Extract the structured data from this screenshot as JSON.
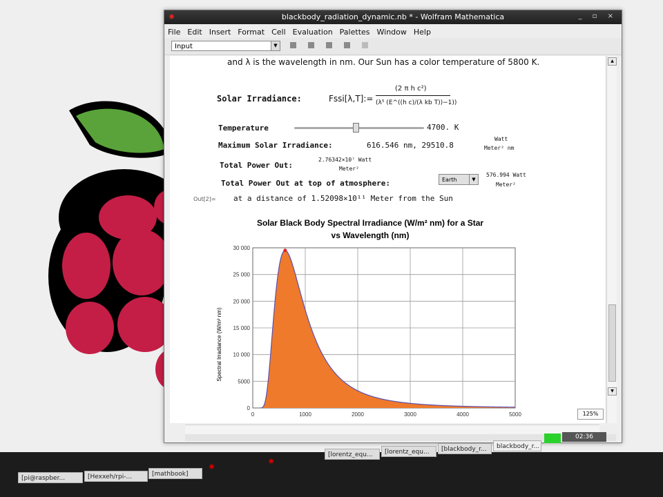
{
  "window": {
    "title": "blackbody_radiation_dynamic.nb * - Wolfram Mathematica",
    "controls": "_ ▫ ×"
  },
  "menu": [
    "File",
    "Edit",
    "Insert",
    "Format",
    "Cell",
    "Evaluation",
    "Palettes",
    "Window",
    "Help"
  ],
  "toolbar": {
    "style_value": "Input"
  },
  "notebook": {
    "intro_text": "and λ is the wavelength in nm. Our Sun has a color temperature of 5800 K.",
    "formula_label": "Solar Irradiance:",
    "formula_lhs": "Fssi[λ,T]:=",
    "formula_num": "(2 π h c²)",
    "formula_den": "(λ⁵ (E^((h c)/(λ kb T))−1))",
    "temperature_label": "Temperature",
    "temperature_value": "4700. K",
    "temperature_fraction": 0.47,
    "max_label": "Maximum Solar Irradiance:",
    "max_value": "616.546 nm, 29510.8",
    "max_unit_num": "Watt",
    "max_unit_den": "Meter² nm",
    "total_label": "Total Power Out:",
    "total_value_num": "2.76342×10⁷ Watt",
    "total_value_den": "Meter²",
    "top_label": "Total Power Out at top of atmosphere:",
    "planet": "Earth",
    "top_value_num": "576.994 Watt",
    "top_value_den": "Meter²",
    "out_label": "Out[2]=",
    "distance_text": "at a distance of 1.52098×10¹¹ Meter from the Sun",
    "zoom": "125%"
  },
  "chart_data": {
    "type": "area",
    "title": "Solar Black Body Spectral Irradiance (W/m² nm) for a Star vs Wavelength (nm)",
    "ylabel": "Spectral Irradiance (W/m² nm)",
    "xlabel": "",
    "xlim": [
      0,
      5000
    ],
    "ylim": [
      0,
      30000
    ],
    "x_ticks": [
      0,
      1000,
      2000,
      3000,
      4000,
      5000
    ],
    "y_ticks": [
      "0",
      "5000",
      "10 000",
      "15 000",
      "20 000",
      "25 000",
      "30 000"
    ],
    "grid": true,
    "temperature_K": 4700,
    "peak_nm": 616.546,
    "peak_value": 29510.8,
    "fill_color": "#ef7a2c",
    "line_color": "#5a4fb0",
    "peak_marker_color": "#e02020"
  },
  "taskbar": {
    "items": [
      "[pi@raspber...",
      "[Hexxeh/rpi-...",
      "[mathbook]",
      "[lorentz_equ...",
      "[lorentz_equ...",
      "[blackbody_r...",
      "blackbody_r..."
    ],
    "clock": "02:36"
  }
}
